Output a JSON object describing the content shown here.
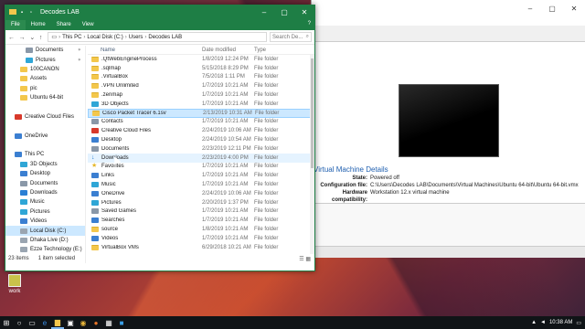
{
  "colors": {
    "accent": "#1e7e45",
    "selection": "#cce8ff",
    "taskbar": "#101417"
  },
  "vmware": {
    "details_title": "Virtual Machine Details",
    "rows": [
      {
        "key": "State:",
        "value": "Powered off"
      },
      {
        "key": "Configuration file:",
        "value": "C:\\Users\\Decodes LAB\\Documents\\Virtual Machines\\Ubuntu 64-bit\\Ubuntu 64-bit.vmx"
      },
      {
        "key": "Hardware compatibility:",
        "value": "Workstation 12.x virtual machine"
      }
    ]
  },
  "explorer": {
    "title": "Decodes LAB",
    "ribbon_tabs": [
      "File",
      "Home",
      "Share",
      "View"
    ],
    "path": [
      "This PC",
      "Local Disk (C:)",
      "Users",
      "Decodes LAB"
    ],
    "search_placeholder": "Search De...",
    "columns": {
      "name": "Name",
      "date": "Date modified",
      "type": "Type"
    },
    "sidebar": [
      {
        "label": "Documents",
        "icon": "documents-icon",
        "pinned": true
      },
      {
        "label": "Pictures",
        "icon": "pictures-icon",
        "pinned": true
      },
      {
        "label": "100CANON",
        "icon": "folder-icon"
      },
      {
        "label": "Assets",
        "icon": "folder-icon"
      },
      {
        "label": "pic",
        "icon": "folder-icon"
      },
      {
        "label": "Ubuntu 64-bit",
        "icon": "folder-icon"
      },
      {
        "label": "",
        "icon": ""
      },
      {
        "label": "Creative Cloud Files",
        "icon": "creative-cloud-icon"
      },
      {
        "label": "",
        "icon": ""
      },
      {
        "label": "OneDrive",
        "icon": "onedrive-icon"
      },
      {
        "label": "",
        "icon": ""
      },
      {
        "label": "This PC",
        "icon": "computer-icon"
      },
      {
        "label": "3D Objects",
        "icon": "3d-objects-icon"
      },
      {
        "label": "Desktop",
        "icon": "desktop-icon"
      },
      {
        "label": "Documents",
        "icon": "documents-icon"
      },
      {
        "label": "Downloads",
        "icon": "downloads-icon"
      },
      {
        "label": "Music",
        "icon": "music-icon"
      },
      {
        "label": "Pictures",
        "icon": "pictures-icon"
      },
      {
        "label": "Videos",
        "icon": "videos-icon"
      },
      {
        "label": "Local Disk (C:)",
        "icon": "drive-icon",
        "selected": true
      },
      {
        "label": "Dhaka Live (D:)",
        "icon": "drive-icon"
      },
      {
        "label": "Ezze Technology (E:)",
        "icon": "drive-icon"
      },
      {
        "label": "",
        "icon": ""
      },
      {
        "label": "Network",
        "icon": "network-icon"
      }
    ],
    "files": [
      {
        "name": ".QtWebEngineProcess",
        "date": "1/8/2019 12:24 PM",
        "type": "File folder",
        "icon": "fold"
      },
      {
        "name": ".sqlmap",
        "date": "5/15/2018 8:29 PM",
        "type": "File folder",
        "icon": "fold"
      },
      {
        "name": ".VirtualBox",
        "date": "7/5/2018 1:11 PM",
        "type": "File folder",
        "icon": "fold"
      },
      {
        "name": ".VPN Unlimited",
        "date": "1/7/2019 10:21 AM",
        "type": "File folder",
        "icon": "fold"
      },
      {
        "name": ".zenmap",
        "date": "1/7/2019 10:21 AM",
        "type": "File folder",
        "icon": "fold"
      },
      {
        "name": "3D Objects",
        "date": "1/7/2019 10:21 AM",
        "type": "File folder",
        "icon": "cyan"
      },
      {
        "name": "Cisco Packet Tracer 6.1sv",
        "date": "2/13/2019 10:31 AM",
        "type": "File folder",
        "icon": "fold",
        "selected": true
      },
      {
        "name": "Contacts",
        "date": "1/7/2019 10:21 AM",
        "type": "File folder",
        "icon": "gray"
      },
      {
        "name": "Creative Cloud Files",
        "date": "2/24/2019 10:06 AM",
        "type": "File folder",
        "icon": "red"
      },
      {
        "name": "Desktop",
        "date": "2/24/2019 10:54 AM",
        "type": "File folder",
        "icon": "blue"
      },
      {
        "name": "Documents",
        "date": "2/23/2019 12:11 PM",
        "type": "File folder",
        "icon": "gray"
      },
      {
        "name": "Downloads",
        "date": "2/23/2019 4:00 PM",
        "type": "File folder",
        "icon": "dl",
        "hover": true
      },
      {
        "name": "Favorites",
        "date": "1/7/2019 10:21 AM",
        "type": "File folder",
        "icon": "star"
      },
      {
        "name": "Links",
        "date": "1/7/2019 10:21 AM",
        "type": "File folder",
        "icon": "blue"
      },
      {
        "name": "Music",
        "date": "1/7/2019 10:21 AM",
        "type": "File folder",
        "icon": "cyan"
      },
      {
        "name": "OneDrive",
        "date": "2/24/2019 10:06 AM",
        "type": "File folder",
        "icon": "blue"
      },
      {
        "name": "Pictures",
        "date": "2/20/2019 1:37 PM",
        "type": "File folder",
        "icon": "cyan"
      },
      {
        "name": "Saved Games",
        "date": "1/7/2019 10:21 AM",
        "type": "File folder",
        "icon": "gray"
      },
      {
        "name": "Searches",
        "date": "1/7/2019 10:21 AM",
        "type": "File folder",
        "icon": "blue"
      },
      {
        "name": "source",
        "date": "1/8/2019 10:21 AM",
        "type": "File folder",
        "icon": "fold"
      },
      {
        "name": "Videos",
        "date": "1/7/2019 10:21 AM",
        "type": "File folder",
        "icon": "blue"
      },
      {
        "name": "VirtualBox VMs",
        "date": "6/29/2018 10:21 AM",
        "type": "File folder",
        "icon": "fold"
      }
    ],
    "status": {
      "count": "23 items",
      "selected": "1 item selected"
    }
  },
  "desktop_icon": {
    "label": "work"
  },
  "taskbar": {
    "time": "10:38 AM"
  }
}
